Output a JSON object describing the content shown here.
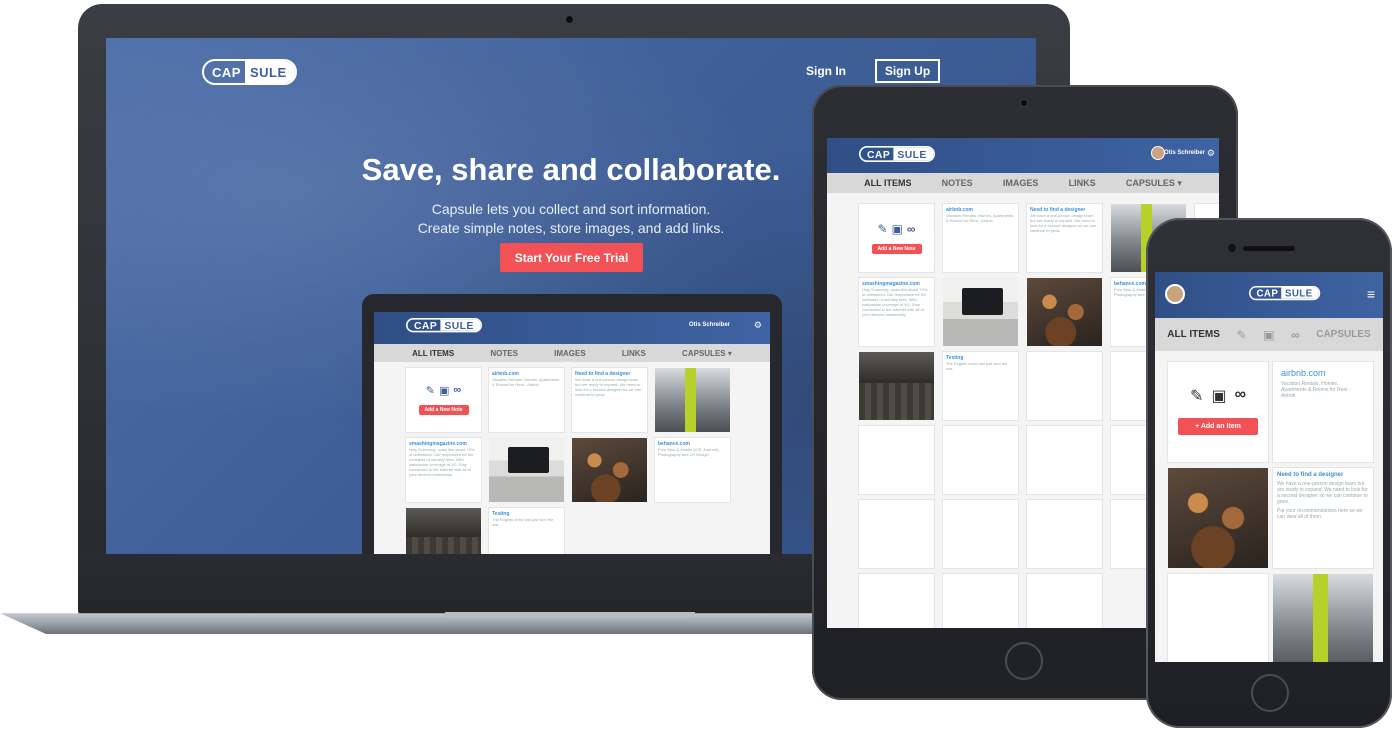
{
  "hero": {
    "logo_left": "CAP",
    "logo_right": "SULE",
    "signin": "Sign In",
    "signup": "Sign Up",
    "title": "Save, share and collaborate.",
    "subtitle_1": "Capsule lets you collect and sort information.",
    "subtitle_2": "Create simple notes, store images, and add links.",
    "cta": "Start Your Free Trial"
  },
  "app": {
    "user_name": "Otis Schreiber",
    "nav": {
      "all_items": "ALL ITEMS",
      "notes": "NOTES",
      "images": "IMAGES",
      "links": "LINKS",
      "capsules": "CAPSULES ▾",
      "capsules_phone": "CAPSULES"
    },
    "add_note": "Add a New Note",
    "add_item": "+ Add an Item",
    "cards": {
      "airbnb_title": "airbnb.com",
      "airbnb_text": "Vacation Rentals, Homes, Apartments & Rooms for Rent - Airbnb",
      "designer_title": "Need to find a designer",
      "designer_text": "We have a one-person design team but are ready to expand. We need to look for a second designer so we can continue to grow.",
      "designer_text_2": "Put your recommendations here so we can view all of them.",
      "smashing_title": "smashingmagazine.com",
      "smashing_text": "Holy Sciencing, looks like about 70% of unfinished. Our responsive for the contracts of monthly fees. With nationwide coverage of 4G. Stay connected to the internet with all of your devices seamlessly.",
      "behance_title": "behance.com",
      "behance_text": "Free Web & Mobile (iOS, Android), Photography and UX Design",
      "testing_title": "Testing",
      "testing_text": "The English army had just won the war."
    }
  }
}
